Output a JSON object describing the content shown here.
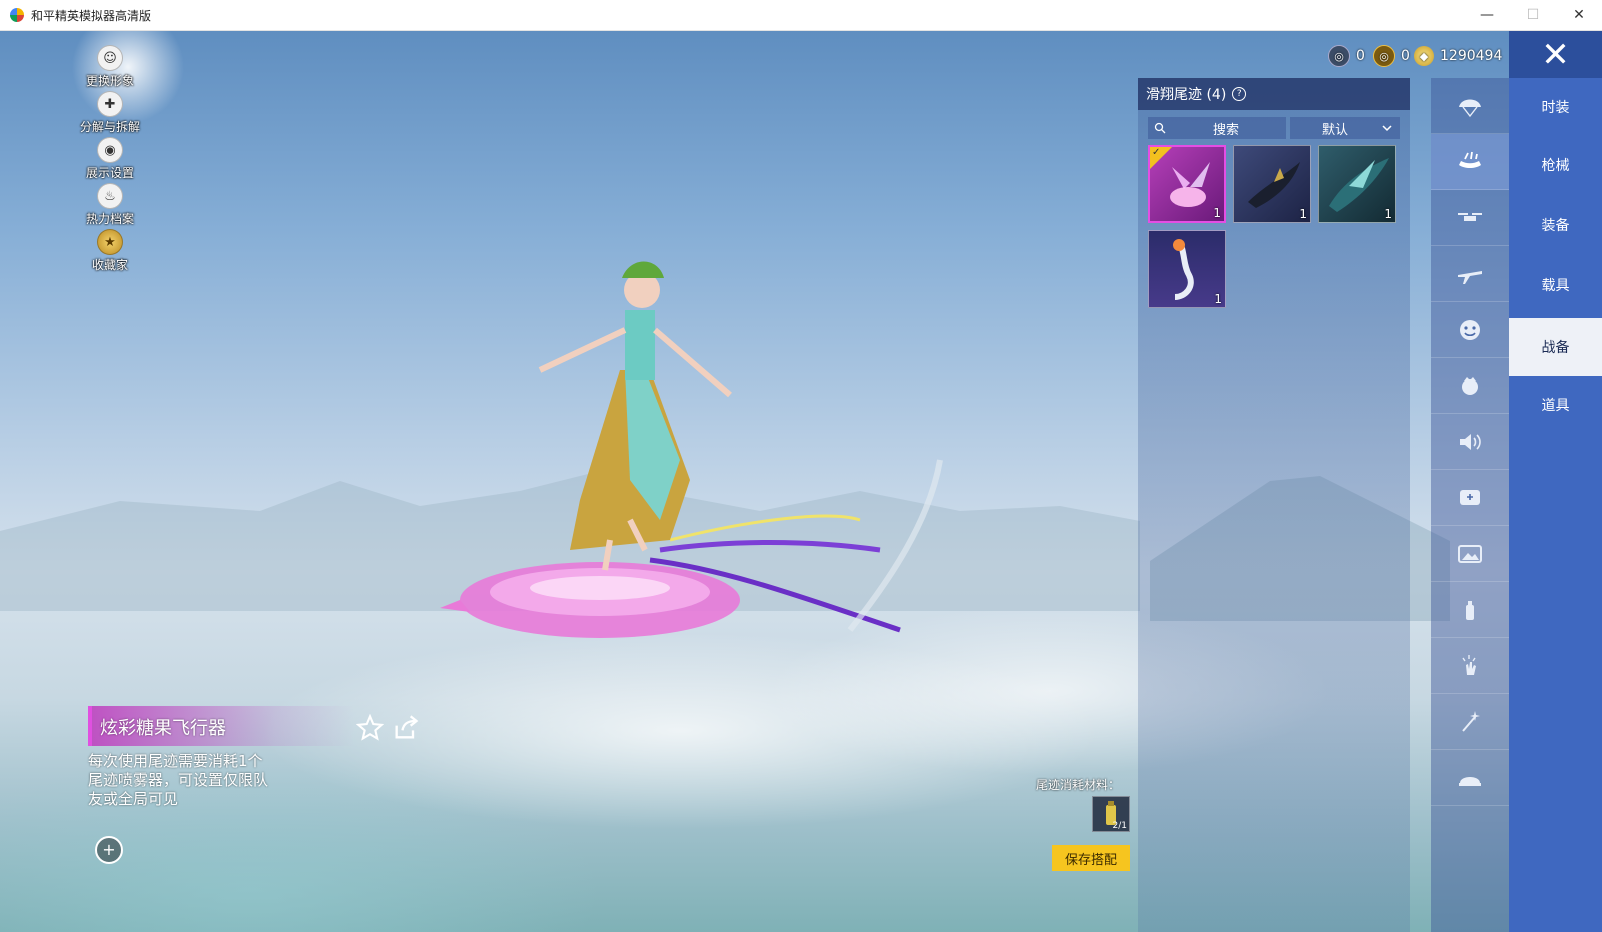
{
  "window": {
    "title": "和平精英模拟器高清版",
    "min": "—",
    "max": "☐",
    "close": "✕"
  },
  "left_menu": [
    {
      "label": "更换形象",
      "icon": "avatar-icon"
    },
    {
      "label": "分解与拆解",
      "icon": "puzzle-icon"
    },
    {
      "label": "展示设置",
      "icon": "eye-icon"
    },
    {
      "label": "热力档案",
      "icon": "flame-icon"
    },
    {
      "label": "收藏家",
      "icon": "collector-badge-icon"
    }
  ],
  "item": {
    "name": "炫彩糖果飞行器",
    "description": "每次使用尾迹需要消耗1个尾迹喷雾器，可设置仅限队友或全局可见",
    "zoom": "+"
  },
  "currency": [
    {
      "name": "silver-coin",
      "value": "0"
    },
    {
      "name": "gold-coin",
      "value": "0"
    },
    {
      "name": "diamond",
      "value": "1290494"
    }
  ],
  "panel": {
    "title": "滑翔尾迹 (4)",
    "help": "?",
    "search_placeholder": "搜索",
    "sort_label": "默认",
    "cards": [
      {
        "qty": "1",
        "selected": true,
        "check": "✓"
      },
      {
        "qty": "1",
        "selected": false
      },
      {
        "qty": "1",
        "selected": false
      },
      {
        "qty": "1",
        "selected": false
      }
    ]
  },
  "consume": {
    "label": "尾迹消耗材料：",
    "count": "2/1"
  },
  "save_button": "保存搭配",
  "close_button": "✕",
  "icon_column": [
    "parachute-icon",
    "glider-trail-icon",
    "drone-icon",
    "plane-icon",
    "emote-face-icon",
    "crown-icon",
    "speaker-icon",
    "dialog-icon",
    "photo-icon",
    "spray-can-icon",
    "hand-tap-icon",
    "sparkle-wand-icon",
    "platter-icon"
  ],
  "categories": [
    "时装",
    "枪械",
    "装备",
    "载具",
    "战备",
    "道具"
  ],
  "active_category_index": 4,
  "active_icon_index": 1,
  "colors": {
    "accent_yellow": "#f6c51f",
    "category_blue": "#3f68c0",
    "selected_pink": "#e44ee4"
  }
}
